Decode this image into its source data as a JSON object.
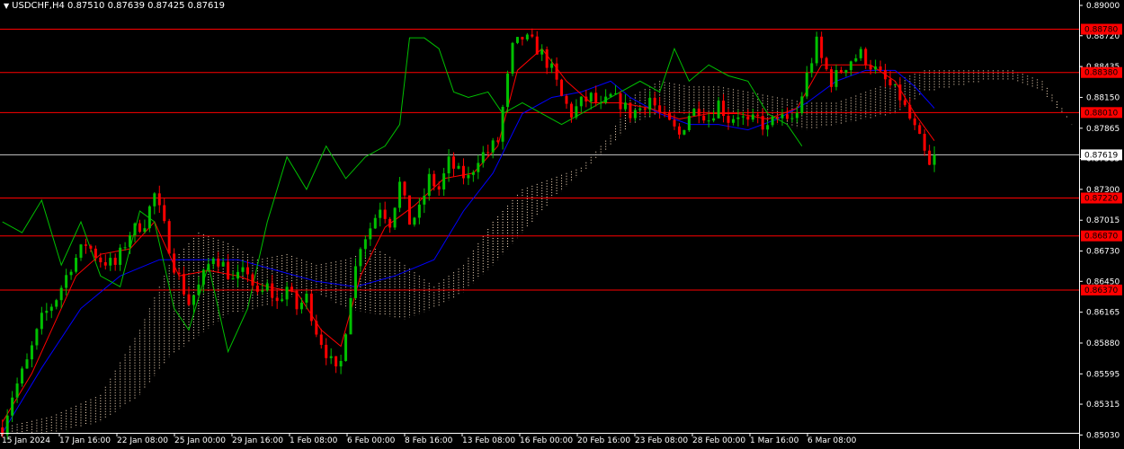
{
  "header": {
    "symbol": "USDCHF,H4",
    "open": "0.87510",
    "high": "0.87639",
    "low": "0.87425",
    "close": "0.87619"
  },
  "colors": {
    "background": "#000000",
    "bull": "#00c000",
    "bear": "#ff0000",
    "tenkan": "#ff0000",
    "kijun": "#0000ff",
    "chikou": "#00c000",
    "kumo": "#ffe4c4",
    "level_line": "#ff0000",
    "level_tag": "#ff0000",
    "price_tag": "#ffffff",
    "axis": "#ffffff"
  },
  "chart_data": {
    "type": "candlestick",
    "indicator": "Ichimoku Kinko Hyo",
    "ylim": [
      0.8505,
      0.8905
    ],
    "y_ticks": [
      "0.89000",
      "0.88720",
      "0.88435",
      "0.88150",
      "0.87865",
      "0.87585",
      "0.87300",
      "0.87015",
      "0.86730",
      "0.86450",
      "0.86165",
      "0.85880",
      "0.85595",
      "0.85315",
      "0.85030"
    ],
    "x_ticks": [
      "15 Jan 2024",
      "17 Jan 16:00",
      "22 Jan 08:00",
      "25 Jan 00:00",
      "29 Jan 16:00",
      "1 Feb 08:00",
      "6 Feb 00:00",
      "8 Feb 16:00",
      "13 Feb 08:00",
      "16 Feb 00:00",
      "20 Feb 16:00",
      "23 Feb 08:00",
      "28 Feb 00:00",
      "1 Mar 16:00",
      "6 Mar 08:00"
    ],
    "levels": [
      {
        "label": "0.88780",
        "value": 0.8878
      },
      {
        "label": "0.88380",
        "value": 0.8838
      },
      {
        "label": "0.88010",
        "value": 0.8801
      },
      {
        "label": "0.87220",
        "value": 0.8722
      },
      {
        "label": "0.86870",
        "value": 0.8687
      },
      {
        "label": "0.86370",
        "value": 0.8637
      }
    ],
    "current_price": {
      "label": "0.87619",
      "value": 0.87619
    },
    "close_path": [
      [
        0,
        0.851
      ],
      [
        2,
        0.854
      ],
      [
        5,
        0.857
      ],
      [
        8,
        0.861
      ],
      [
        11,
        0.863
      ],
      [
        14,
        0.866
      ],
      [
        17,
        0.868
      ],
      [
        20,
        0.8665
      ],
      [
        23,
        0.866
      ],
      [
        26,
        0.869
      ],
      [
        29,
        0.87
      ],
      [
        31,
        0.8725
      ],
      [
        33,
        0.8695
      ],
      [
        35,
        0.866
      ],
      [
        38,
        0.8625
      ],
      [
        40,
        0.864
      ],
      [
        43,
        0.867
      ],
      [
        45,
        0.866
      ],
      [
        47,
        0.8645
      ],
      [
        50,
        0.8655
      ],
      [
        52,
        0.863
      ],
      [
        54,
        0.864
      ],
      [
        56,
        0.8625
      ],
      [
        58,
        0.864
      ],
      [
        60,
        0.862
      ],
      [
        62,
        0.863
      ],
      [
        64,
        0.86
      ],
      [
        66,
        0.858
      ],
      [
        68,
        0.856
      ],
      [
        69,
        0.857
      ],
      [
        71,
        0.8635
      ],
      [
        73,
        0.868
      ],
      [
        75,
        0.8695
      ],
      [
        77,
        0.8715
      ],
      [
        79,
        0.87
      ],
      [
        81,
        0.8735
      ],
      [
        83,
        0.87
      ],
      [
        85,
        0.871
      ],
      [
        87,
        0.874
      ],
      [
        89,
        0.873
      ],
      [
        91,
        0.8755
      ],
      [
        93,
        0.8745
      ],
      [
        95,
        0.874
      ],
      [
        97,
        0.876
      ],
      [
        99,
        0.8765
      ],
      [
        101,
        0.8775
      ],
      [
        102,
        0.8805
      ],
      [
        104,
        0.886
      ],
      [
        106,
        0.887
      ],
      [
        108,
        0.8865
      ],
      [
        110,
        0.8855
      ],
      [
        112,
        0.884
      ],
      [
        114,
        0.8815
      ],
      [
        116,
        0.88
      ],
      [
        118,
        0.881
      ],
      [
        120,
        0.8815
      ],
      [
        122,
        0.8805
      ],
      [
        124,
        0.8815
      ],
      [
        126,
        0.881
      ],
      [
        128,
        0.88
      ],
      [
        130,
        0.8805
      ],
      [
        132,
        0.8815
      ],
      [
        134,
        0.88
      ],
      [
        136,
        0.879
      ],
      [
        138,
        0.878
      ],
      [
        140,
        0.88
      ],
      [
        142,
        0.8805
      ],
      [
        144,
        0.8795
      ],
      [
        146,
        0.881
      ],
      [
        148,
        0.8795
      ],
      [
        150,
        0.88
      ],
      [
        152,
        0.879
      ],
      [
        154,
        0.8795
      ],
      [
        156,
        0.8785
      ],
      [
        158,
        0.88
      ],
      [
        160,
        0.879
      ],
      [
        162,
        0.88
      ],
      [
        164,
        0.8835
      ],
      [
        166,
        0.8865
      ],
      [
        167,
        0.885
      ],
      [
        169,
        0.883
      ],
      [
        171,
        0.884
      ],
      [
        173,
        0.885
      ],
      [
        175,
        0.8855
      ],
      [
        177,
        0.8845
      ],
      [
        179,
        0.8835
      ],
      [
        181,
        0.8825
      ],
      [
        183,
        0.8815
      ],
      [
        185,
        0.8795
      ],
      [
        187,
        0.8775
      ],
      [
        189,
        0.875
      ],
      [
        190,
        0.8762
      ]
    ],
    "tenkan_path": [
      [
        0,
        0.8515
      ],
      [
        6,
        0.856
      ],
      [
        10,
        0.86
      ],
      [
        15,
        0.865
      ],
      [
        20,
        0.867
      ],
      [
        26,
        0.8675
      ],
      [
        31,
        0.87
      ],
      [
        36,
        0.865
      ],
      [
        42,
        0.8655
      ],
      [
        48,
        0.865
      ],
      [
        54,
        0.864
      ],
      [
        60,
        0.8635
      ],
      [
        65,
        0.86
      ],
      [
        69,
        0.8585
      ],
      [
        73,
        0.865
      ],
      [
        78,
        0.8695
      ],
      [
        84,
        0.8715
      ],
      [
        90,
        0.874
      ],
      [
        96,
        0.8745
      ],
      [
        101,
        0.877
      ],
      [
        105,
        0.884
      ],
      [
        110,
        0.886
      ],
      [
        115,
        0.883
      ],
      [
        120,
        0.881
      ],
      [
        126,
        0.881
      ],
      [
        132,
        0.8805
      ],
      [
        138,
        0.8795
      ],
      [
        144,
        0.88
      ],
      [
        150,
        0.88
      ],
      [
        156,
        0.8795
      ],
      [
        162,
        0.8805
      ],
      [
        167,
        0.8845
      ],
      [
        172,
        0.8845
      ],
      [
        177,
        0.8845
      ],
      [
        182,
        0.883
      ],
      [
        186,
        0.88
      ],
      [
        190,
        0.8775
      ]
    ],
    "kijun_path": [
      [
        0,
        0.8505
      ],
      [
        8,
        0.8565
      ],
      [
        16,
        0.862
      ],
      [
        24,
        0.865
      ],
      [
        32,
        0.8665
      ],
      [
        40,
        0.8665
      ],
      [
        48,
        0.8665
      ],
      [
        56,
        0.8655
      ],
      [
        64,
        0.8645
      ],
      [
        72,
        0.864
      ],
      [
        80,
        0.865
      ],
      [
        88,
        0.8665
      ],
      [
        94,
        0.871
      ],
      [
        100,
        0.8745
      ],
      [
        106,
        0.88
      ],
      [
        112,
        0.8815
      ],
      [
        118,
        0.882
      ],
      [
        124,
        0.883
      ],
      [
        128,
        0.8815
      ],
      [
        134,
        0.88
      ],
      [
        140,
        0.879
      ],
      [
        146,
        0.879
      ],
      [
        152,
        0.8785
      ],
      [
        158,
        0.8795
      ],
      [
        164,
        0.881
      ],
      [
        170,
        0.883
      ],
      [
        176,
        0.884
      ],
      [
        182,
        0.884
      ],
      [
        186,
        0.8825
      ],
      [
        190,
        0.8805
      ]
    ],
    "chikou_path": [
      [
        0,
        0.87
      ],
      [
        4,
        0.869
      ],
      [
        8,
        0.872
      ],
      [
        12,
        0.866
      ],
      [
        16,
        0.87
      ],
      [
        20,
        0.865
      ],
      [
        24,
        0.864
      ],
      [
        28,
        0.871
      ],
      [
        31,
        0.87
      ],
      [
        35,
        0.862
      ],
      [
        38,
        0.86
      ],
      [
        42,
        0.866
      ],
      [
        46,
        0.858
      ],
      [
        50,
        0.862
      ],
      [
        54,
        0.87
      ],
      [
        58,
        0.876
      ],
      [
        62,
        0.873
      ],
      [
        66,
        0.877
      ],
      [
        70,
        0.874
      ],
      [
        74,
        0.876
      ],
      [
        78,
        0.877
      ],
      [
        81,
        0.879
      ],
      [
        83,
        0.887
      ],
      [
        86,
        0.887
      ],
      [
        89,
        0.886
      ],
      [
        92,
        0.882
      ],
      [
        95,
        0.8815
      ],
      [
        99,
        0.882
      ],
      [
        102,
        0.88
      ],
      [
        106,
        0.881
      ],
      [
        110,
        0.88
      ],
      [
        114,
        0.879
      ],
      [
        118,
        0.88
      ],
      [
        122,
        0.881
      ],
      [
        126,
        0.882
      ],
      [
        130,
        0.883
      ],
      [
        134,
        0.882
      ],
      [
        137,
        0.886
      ],
      [
        140,
        0.883
      ],
      [
        144,
        0.8845
      ],
      [
        148,
        0.8835
      ],
      [
        152,
        0.883
      ],
      [
        156,
        0.88
      ],
      [
        160,
        0.879
      ],
      [
        163,
        0.877
      ]
    ],
    "kumo_top": [
      [
        0,
        0.851
      ],
      [
        10,
        0.852
      ],
      [
        20,
        0.854
      ],
      [
        28,
        0.86
      ],
      [
        34,
        0.866
      ],
      [
        40,
        0.869
      ],
      [
        46,
        0.868
      ],
      [
        52,
        0.8665
      ],
      [
        58,
        0.867
      ],
      [
        64,
        0.866
      ],
      [
        70,
        0.8665
      ],
      [
        76,
        0.8675
      ],
      [
        82,
        0.866
      ],
      [
        88,
        0.864
      ],
      [
        94,
        0.866
      ],
      [
        100,
        0.87
      ],
      [
        106,
        0.873
      ],
      [
        112,
        0.874
      ],
      [
        118,
        0.875
      ],
      [
        124,
        0.878
      ],
      [
        128,
        0.8815
      ],
      [
        134,
        0.883
      ],
      [
        140,
        0.8825
      ],
      [
        146,
        0.8825
      ],
      [
        152,
        0.882
      ],
      [
        158,
        0.8815
      ],
      [
        164,
        0.881
      ],
      [
        170,
        0.881
      ],
      [
        176,
        0.882
      ],
      [
        182,
        0.883
      ],
      [
        188,
        0.884
      ],
      [
        194,
        0.884
      ],
      [
        200,
        0.884
      ],
      [
        206,
        0.884
      ],
      [
        212,
        0.883
      ],
      [
        216,
        0.8805
      ],
      [
        218,
        0.879
      ]
    ],
    "kumo_bottom": [
      [
        0,
        0.8505
      ],
      [
        10,
        0.8505
      ],
      [
        20,
        0.8515
      ],
      [
        28,
        0.854
      ],
      [
        34,
        0.8575
      ],
      [
        40,
        0.8595
      ],
      [
        46,
        0.8615
      ],
      [
        52,
        0.862
      ],
      [
        58,
        0.863
      ],
      [
        64,
        0.8635
      ],
      [
        70,
        0.862
      ],
      [
        76,
        0.8615
      ],
      [
        82,
        0.861
      ],
      [
        88,
        0.862
      ],
      [
        94,
        0.8635
      ],
      [
        100,
        0.866
      ],
      [
        106,
        0.869
      ],
      [
        112,
        0.872
      ],
      [
        118,
        0.8745
      ],
      [
        124,
        0.877
      ],
      [
        128,
        0.879
      ],
      [
        134,
        0.88
      ],
      [
        140,
        0.88
      ],
      [
        146,
        0.88
      ],
      [
        152,
        0.88
      ],
      [
        158,
        0.879
      ],
      [
        164,
        0.8785
      ],
      [
        170,
        0.879
      ],
      [
        176,
        0.8795
      ],
      [
        182,
        0.88
      ],
      [
        188,
        0.882
      ],
      [
        194,
        0.8825
      ],
      [
        200,
        0.883
      ],
      [
        206,
        0.883
      ],
      [
        212,
        0.882
      ],
      [
        216,
        0.88
      ],
      [
        218,
        0.879
      ]
    ],
    "bar_count": 191
  }
}
